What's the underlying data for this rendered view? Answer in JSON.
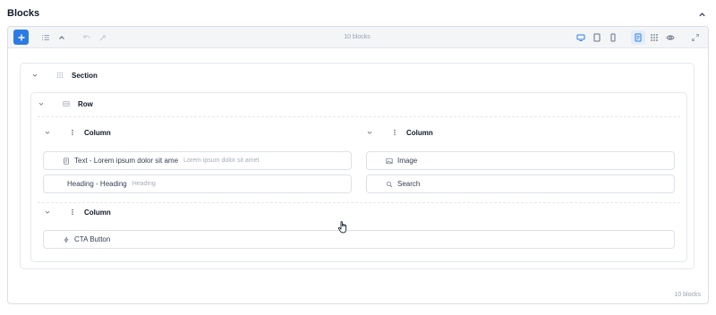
{
  "header": {
    "title": "Blocks",
    "collapse_icon": "chevron-up-icon"
  },
  "toolbar": {
    "add_icon": "plus-icon",
    "block_count": "10 blocks",
    "left_tools": [
      "list-icon",
      "chevron-up-icon",
      "undo-icon",
      "redo-icon"
    ],
    "right_tools": [
      "desktop-icon",
      "tablet-icon",
      "mobile-icon",
      "document-icon",
      "grid-icon",
      "eye-icon",
      "fullscreen-icon"
    ],
    "active_tool": "document-icon",
    "accent": "#2c7be5"
  },
  "tree": {
    "section": {
      "label": "Section"
    },
    "row": {
      "label": "Row"
    },
    "columns": [
      {
        "label": "Column"
      },
      {
        "label": "Column"
      },
      {
        "label": "Column"
      }
    ],
    "blocks": {
      "text": {
        "label": "Text - Lorem ipsum dolor sit ame",
        "preview": "Lorem ipsum dolor sit amet"
      },
      "heading": {
        "label": "Heading - Heading",
        "preview": "Heading"
      },
      "image": {
        "label": "Image"
      },
      "search": {
        "label": "Search"
      },
      "cta": {
        "label": "CTA Button"
      }
    }
  },
  "footer": {
    "block_count": "10 blocks"
  }
}
